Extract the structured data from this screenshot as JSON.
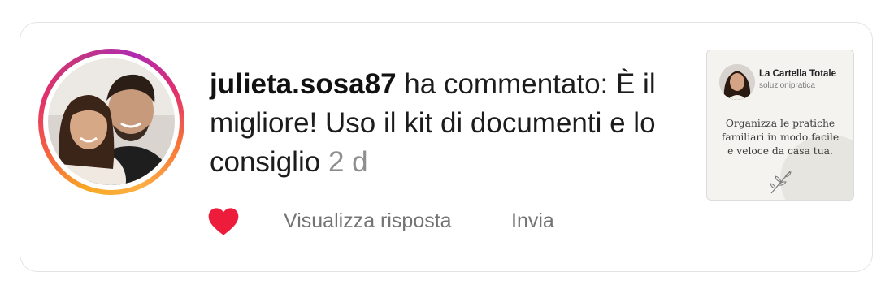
{
  "comment": {
    "username": "julieta.sosa87",
    "text": " ha commentato: È il migliore! Uso il kit di documenti e lo consiglio",
    "time_ago": "2 d"
  },
  "actions": {
    "like_icon": "heart-icon",
    "view_replies_label": "Visualizza risposta",
    "send_label": "Invia"
  },
  "post_thumbnail": {
    "account_name": "La Cartella Totale",
    "account_handle": "soluzionipratica",
    "caption": "Organizza le pratiche familiari in modo facile e veloce da casa tua.",
    "decoration_icon": "leaf-sprig-icon"
  },
  "colors": {
    "heart": "#ed1c3b",
    "username": "#111111",
    "muted": "#737373",
    "time": "#8e8e8e",
    "ring_start": "#f9a825",
    "ring_end": "#c13584"
  }
}
